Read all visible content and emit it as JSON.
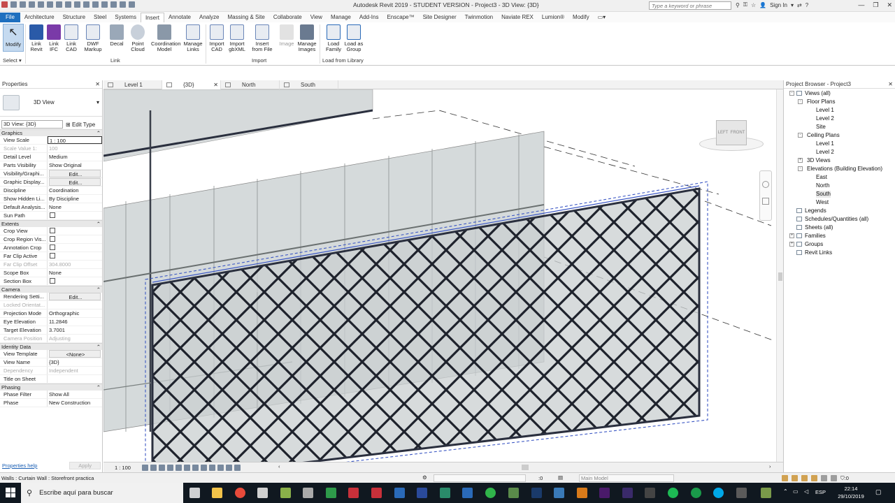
{
  "title_bar": {
    "title": "Autodesk Revit 2019 - STUDENT VERSION - Project3 - 3D View: {3D}",
    "search_placeholder": "Type a keyword or phrase",
    "sign_in": "Sign In"
  },
  "ribbon_tabs": [
    "File",
    "Architecture",
    "Structure",
    "Steel",
    "Systems",
    "Insert",
    "Annotate",
    "Analyze",
    "Massing & Site",
    "Collaborate",
    "View",
    "Manage",
    "Add-Ins",
    "Enscape™",
    "Site Designer",
    "Twinmotion",
    "Naviate REX",
    "Lumion®",
    "Modify"
  ],
  "active_ribbon_tab": "Insert",
  "ribbon": {
    "modify": "Modify",
    "select": "Select",
    "link_revit": "Link\nRevit",
    "link_ifc": "Link\nIFC",
    "link_cad": "Link\nCAD",
    "dwf_markup": "DWF\nMarkup",
    "decal": "Decal",
    "point_cloud": "Point\nCloud",
    "coordination_model": "Coordination\nModel",
    "manage_links": "Manage\nLinks",
    "import_cad": "Import\nCAD",
    "import_gbxml": "Import\ngbXML",
    "insert_from_file": "Insert\nfrom File",
    "image": "Image",
    "manage_images": "Manage\nImages",
    "load_family": "Load\nFamily",
    "load_as_group": "Load as\nGroup",
    "group_link": "Link",
    "group_import": "Import",
    "group_load": "Load from Library"
  },
  "properties": {
    "title": "Properties",
    "type_name": "3D View",
    "instance_selector": "3D View: {3D}",
    "edit_type": "Edit Type",
    "categories": [
      {
        "name": "Graphics",
        "rows": [
          {
            "k": "View Scale",
            "v": "1 : 100",
            "style": "sel"
          },
          {
            "k": "Scale Value    1:",
            "v": "100",
            "style": "dim"
          },
          {
            "k": "Detail Level",
            "v": "Medium"
          },
          {
            "k": "Parts Visibility",
            "v": "Show Original"
          },
          {
            "k": "Visibility/Graphi...",
            "v": "Edit...",
            "style": "btn"
          },
          {
            "k": "Graphic Display...",
            "v": "Edit...",
            "style": "btn"
          },
          {
            "k": "Discipline",
            "v": "Coordination"
          },
          {
            "k": "Show Hidden Li...",
            "v": "By Discipline"
          },
          {
            "k": "Default Analysis...",
            "v": "None"
          },
          {
            "k": "Sun Path",
            "v": "",
            "style": "chk"
          }
        ]
      },
      {
        "name": "Extents",
        "rows": [
          {
            "k": "Crop View",
            "v": "",
            "style": "chk"
          },
          {
            "k": "Crop Region Vis...",
            "v": "",
            "style": "chk"
          },
          {
            "k": "Annotation Crop",
            "v": "",
            "style": "chk"
          },
          {
            "k": "Far Clip Active",
            "v": "",
            "style": "chk"
          },
          {
            "k": "Far Clip Offset",
            "v": "304.8000",
            "style": "dim"
          },
          {
            "k": "Scope Box",
            "v": "None"
          },
          {
            "k": "Section Box",
            "v": "",
            "style": "chk"
          }
        ]
      },
      {
        "name": "Camera",
        "rows": [
          {
            "k": "Rendering Setti...",
            "v": "Edit...",
            "style": "btn"
          },
          {
            "k": "Locked Orientat...",
            "v": "",
            "style": "dim"
          },
          {
            "k": "Projection Mode",
            "v": "Orthographic"
          },
          {
            "k": "Eye Elevation",
            "v": "11.2846"
          },
          {
            "k": "Target Elevation",
            "v": "3.7001"
          },
          {
            "k": "Camera Position",
            "v": "Adjusting",
            "style": "dim"
          }
        ]
      },
      {
        "name": "Identity Data",
        "rows": [
          {
            "k": "View Template",
            "v": "<None>",
            "style": "btn"
          },
          {
            "k": "View Name",
            "v": "{3D}"
          },
          {
            "k": "Dependency",
            "v": "Independent",
            "style": "dim"
          },
          {
            "k": "Title on Sheet",
            "v": ""
          }
        ]
      },
      {
        "name": "Phasing",
        "rows": [
          {
            "k": "Phase Filter",
            "v": "Show All"
          },
          {
            "k": "Phase",
            "v": "New Construction"
          }
        ]
      }
    ],
    "help_link": "Properties help",
    "apply": "Apply"
  },
  "view_tabs": [
    {
      "label": "Level 1",
      "active": false
    },
    {
      "label": "{3D}",
      "active": true
    },
    {
      "label": "North",
      "active": false
    },
    {
      "label": "South",
      "active": false
    }
  ],
  "view_cube": {
    "left": "LEFT",
    "front": "FRONT"
  },
  "view_bar": {
    "scale": "1 : 100"
  },
  "project_browser": {
    "title": "Project Browser - Project3",
    "tree": [
      {
        "label": "Views (all)",
        "depth": 0,
        "exp": "-"
      },
      {
        "label": "Floor Plans",
        "depth": 1,
        "exp": "-"
      },
      {
        "label": "Level 1",
        "depth": 2
      },
      {
        "label": "Level 2",
        "depth": 2
      },
      {
        "label": "Site",
        "depth": 2
      },
      {
        "label": "Ceiling Plans",
        "depth": 1,
        "exp": "-"
      },
      {
        "label": "Level 1",
        "depth": 2
      },
      {
        "label": "Level 2",
        "depth": 2
      },
      {
        "label": "3D Views",
        "depth": 1,
        "exp": "+"
      },
      {
        "label": "Elevations (Building Elevation)",
        "depth": 1,
        "exp": "-"
      },
      {
        "label": "East",
        "depth": 2
      },
      {
        "label": "North",
        "depth": 2
      },
      {
        "label": "South",
        "depth": 2,
        "selected": true
      },
      {
        "label": "West",
        "depth": 2
      },
      {
        "label": "Legends",
        "depth": 0,
        "exp": ""
      },
      {
        "label": "Schedules/Quantities (all)",
        "depth": 0,
        "exp": ""
      },
      {
        "label": "Sheets (all)",
        "depth": 0,
        "exp": ""
      },
      {
        "label": "Families",
        "depth": 0,
        "exp": "+"
      },
      {
        "label": "Groups",
        "depth": 0,
        "exp": "+"
      },
      {
        "label": "Revit Links",
        "depth": 0,
        "exp": ""
      }
    ]
  },
  "status_bar": {
    "message": "Walls : Curtain Wall : Storefront practica",
    "selection_count": ":0",
    "model": "Main Model",
    "filter_count": ":0"
  },
  "taskbar": {
    "search": "Escribe aquí para buscar",
    "language": "ESP",
    "time": "22:14",
    "date": "29/10/2019"
  },
  "colors": {
    "file_tab": "#1e6fbf",
    "mullion": "#2a2f3e",
    "selection": "#3b57c4",
    "glass": "#d5dadb"
  }
}
